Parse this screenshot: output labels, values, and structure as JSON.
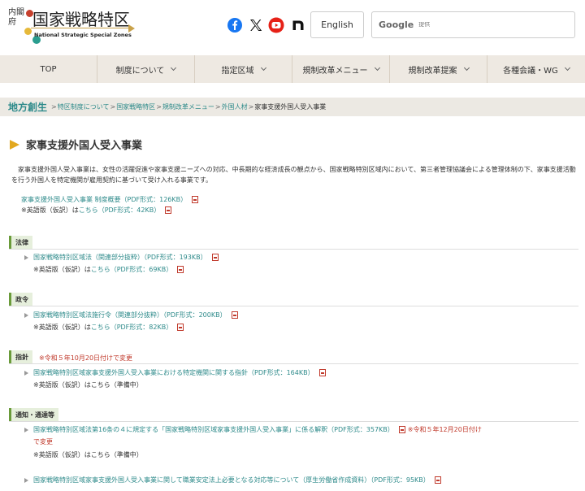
{
  "logo": {
    "vertical_text": "内閣府",
    "main_text": "国家戦略特区",
    "sub_text": "National Strategic Special Zones"
  },
  "social": {
    "facebook_icon": "facebook-icon",
    "x_icon": "x-icon",
    "youtube_icon": "youtube-icon",
    "note_icon": "note-icon"
  },
  "header": {
    "english_label": "English",
    "search_brand": "Google",
    "search_placeholder": "提供"
  },
  "nav": {
    "items": [
      {
        "label": "TOP",
        "has_dropdown": false
      },
      {
        "label": "制度について",
        "has_dropdown": true
      },
      {
        "label": "指定区域",
        "has_dropdown": true
      },
      {
        "label": "規制改革メニュー",
        "has_dropdown": true
      },
      {
        "label": "規制改革提案",
        "has_dropdown": true
      },
      {
        "label": "各種会議・WG",
        "has_dropdown": true
      }
    ]
  },
  "breadcrumb": {
    "title": "地方創生",
    "links": [
      "特区制度について",
      "国家戦略特区",
      "規制改革メニュー",
      "外国人材"
    ],
    "current": "家事支援外国人受入事業"
  },
  "page": {
    "title": "家事支援外国人受入事業",
    "intro": "家事支援外国人受入事業は、女性の活躍促進や家事支援ニーズへの対応、中長期的な経済成長の観点から、国家戦略特別区域内において、第三者管理協議会による管理体制の下、家事支援活動を行う外国人を特定機関が雇用契約に基づいて受け入れる事業です。",
    "overview_link": "家事支援外国人受入事業 制度概要（PDF形式：126KB）",
    "overview_note_prefix": "※英語版（仮訳）は",
    "overview_note_link": "こちら（PDF形式：42KB）"
  },
  "sections": {
    "law": {
      "label": "法律",
      "link": "国家戦略特別区域法（関連部分抜粋）（PDF形式：193KB）",
      "note_prefix": "※英語版（仮訳）は",
      "note_link": "こちら（PDF形式：69KB）"
    },
    "ordinance": {
      "label": "政令",
      "link": "国家戦略特別区域法施行令（関連部分抜粋）（PDF形式：200KB）",
      "note_prefix": "※英語版（仮訳）は",
      "note_link": "こちら（PDF形式：82KB）"
    },
    "guideline": {
      "label": "指針",
      "red_note": "※令和５年10月20日付けで変更",
      "link": "国家戦略特別区域家事支援外国人受入事業における特定機関に関する指針（PDF形式：164KB）",
      "note": "※英語版（仮訳）はこちら（準備中）"
    },
    "notices": {
      "label": "通知・通達等",
      "link1": "国家戦略特別区域法第16条の４に規定する「国家戦略特別区域家事支援外国人受入事業」に係る解釈（PDF形式：357KB）",
      "red_note1a": "※令和５年12月20日付け",
      "red_note1b": "で変更",
      "note1": "※英語版（仮訳）はこちら（準備中）",
      "link2": "国家戦略特別区域家事支援外国人受入事業に関して職業安定法上必要となる対応等について（厚生労働省作成資料）（PDF形式：95KB）"
    }
  },
  "colors": {
    "link": "#2d8a8a",
    "nav_bg": "#eee9e2",
    "accent_gold": "#e2a81f",
    "section_green": "#6a9b3a",
    "note_red": "#c0392b"
  }
}
